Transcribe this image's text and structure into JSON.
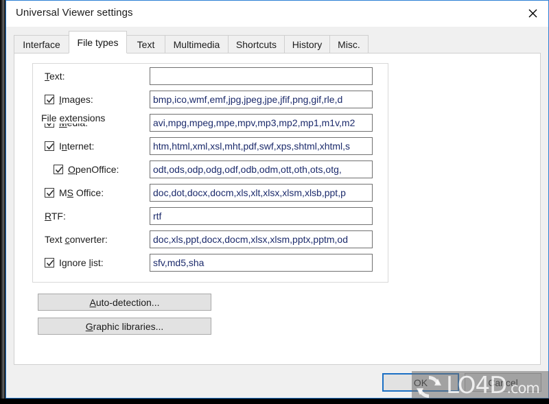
{
  "window": {
    "title": "Universal Viewer settings",
    "close_icon": "close-icon"
  },
  "tabs": [
    {
      "label": "Interface",
      "active": false
    },
    {
      "label": "File types",
      "active": true
    },
    {
      "label": "Text",
      "active": false
    },
    {
      "label": "Multimedia",
      "active": false
    },
    {
      "label": "Shortcuts",
      "active": false
    },
    {
      "label": "History",
      "active": false
    },
    {
      "label": "Misc.",
      "active": false
    }
  ],
  "groupbox": {
    "title": "File extensions"
  },
  "rows": [
    {
      "label": "Text:",
      "accel": "T",
      "checkbox": false,
      "indent": false,
      "value": "",
      "name": "text"
    },
    {
      "label": "Images:",
      "accel": "I",
      "checkbox": true,
      "checked": true,
      "indent": false,
      "value": "bmp,ico,wmf,emf,jpg,jpeg,jpe,jfif,png,gif,rle,d",
      "name": "images"
    },
    {
      "label": "Media:",
      "accel": "M",
      "checkbox": true,
      "checked": true,
      "indent": false,
      "value": "avi,mpg,mpeg,mpe,mpv,mp3,mp2,mp1,m1v,m2",
      "name": "media"
    },
    {
      "label": "Internet:",
      "accel": "n",
      "checkbox": true,
      "checked": true,
      "indent": false,
      "value": "htm,html,xml,xsl,mht,pdf,swf,xps,shtml,xhtml,s",
      "name": "internet"
    },
    {
      "label": "OpenOffice:",
      "accel": "O",
      "checkbox": true,
      "checked": true,
      "indent": true,
      "value": "odt,ods,odp,odg,odf,odb,odm,ott,oth,ots,otg,",
      "name": "openoffice"
    },
    {
      "label": "MS Office:",
      "accel": "S",
      "checkbox": true,
      "checked": true,
      "indent": false,
      "value": "doc,dot,docx,docm,xls,xlt,xlsx,xlsm,xlsb,ppt,p",
      "name": "ms-office"
    },
    {
      "label": "RTF:",
      "accel": "R",
      "checkbox": false,
      "indent": false,
      "value": "rtf",
      "name": "rtf"
    },
    {
      "label": "Text converter:",
      "accel": "c",
      "checkbox": false,
      "indent": false,
      "value": "doc,xls,ppt,docx,docm,xlsx,xlsm,pptx,pptm,od",
      "name": "text-converter"
    },
    {
      "label": "Ignore list:",
      "accel": "l",
      "checkbox": true,
      "checked": true,
      "indent": false,
      "value": "sfv,md5,sha",
      "name": "ignore-list"
    }
  ],
  "buttons": {
    "auto_detection": "Auto-detection...",
    "graphic_libraries": "Graphic libraries...",
    "ok": "OK",
    "cancel": "Cancel"
  },
  "watermark": {
    "text": "LO4D",
    "suffix": ".com"
  },
  "colors": {
    "accent": "#1a6fc4",
    "field_text": "#1b2a6b",
    "window_bg": "#f0f0f0",
    "panel_bg": "#ffffff",
    "button_bg": "#e2e2e2"
  }
}
